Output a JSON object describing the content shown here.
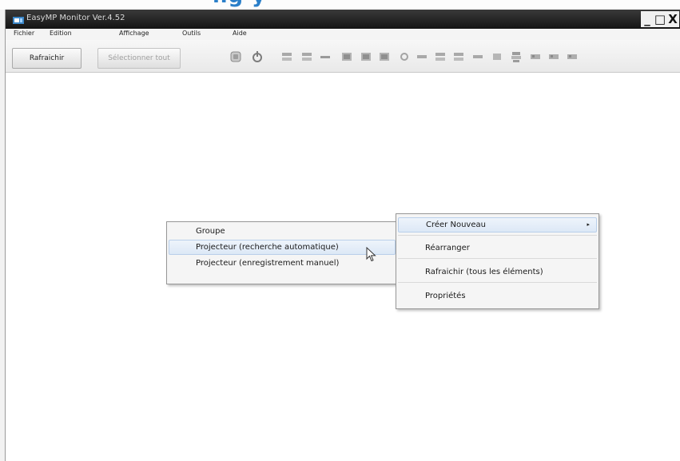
{
  "window": {
    "title": "EasyMP Monitor Ver.4.52",
    "minimize": "_",
    "maximize": "□",
    "close": "X"
  },
  "background_heading": "ng&nbsp;y",
  "menu": [
    {
      "label": "Fichier"
    },
    {
      "label": "Edition"
    },
    {
      "label": "Affichage"
    },
    {
      "label": "Outils"
    },
    {
      "label": "Aide"
    }
  ],
  "toolbar": {
    "refresh_label": "Rafraichir",
    "select_all_label": "Sélectionner tout",
    "icons": [
      "monitor-off-icon",
      "power-icon",
      "projector-grid-icon",
      "projector-grid-icon",
      "dash-icon",
      "projector-view-icon",
      "projector-view-icon",
      "projector-view-icon",
      "gear-small-icon",
      "bar-icon",
      "projector-grid-icon",
      "projector-grid-icon",
      "bar-icon",
      "display-icon",
      "stack-icon",
      "projector-small-icon",
      "projector-small-icon",
      "projector-small-icon"
    ]
  },
  "context_menu": {
    "left": [
      {
        "label": "Groupe"
      },
      {
        "label": "Projecteur (recherche automatique)"
      },
      {
        "label": "Projecteur (enregistrement manuel)"
      }
    ],
    "right": [
      {
        "label": "Créer Nouveau",
        "arrow": "▸"
      },
      {
        "label": "Réarranger"
      },
      {
        "label": "Rafraichir (tous les éléments)"
      },
      {
        "label": "Propriétés"
      }
    ]
  },
  "colors": {
    "titlebar": "#1e1e1e",
    "highlight": "#dce8f6",
    "heading": "#2a7fc9"
  }
}
